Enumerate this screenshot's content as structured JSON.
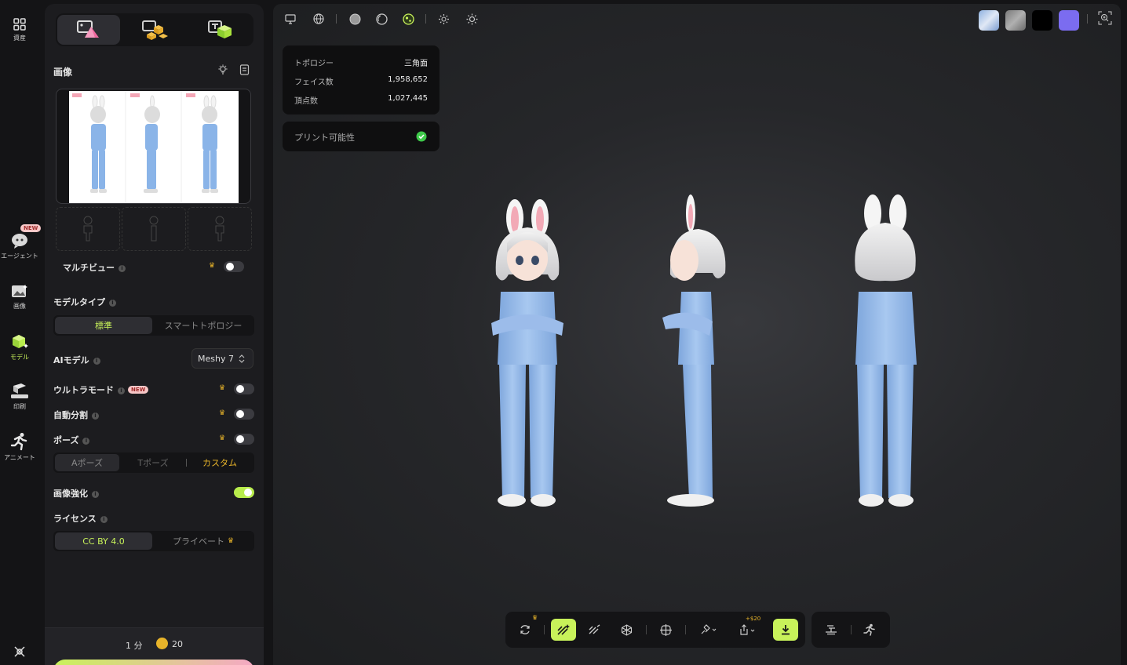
{
  "rail": {
    "items": [
      {
        "label": "資産",
        "icon": "grid-icon"
      },
      {
        "label": "エージェント",
        "icon": "agent-icon",
        "badge": "NEW"
      },
      {
        "label": "画像",
        "icon": "image-icon"
      },
      {
        "label": "モデル",
        "icon": "model-cube-icon",
        "active": true
      },
      {
        "label": "印刷",
        "icon": "printer-icon"
      },
      {
        "label": "アニメート",
        "icon": "running-figure-icon"
      }
    ]
  },
  "panel": {
    "image_section_title": "画像",
    "multiview": {
      "label": "マルチビュー",
      "enabled": false
    },
    "model_type": {
      "label": "モデルタイプ",
      "options": [
        "標準",
        "スマートトポロジー"
      ],
      "selected": "標準"
    },
    "ai_model": {
      "label": "AIモデル",
      "value": "Meshy 7"
    },
    "ultra_mode": {
      "label": "ウルトラモード",
      "badge": "NEW",
      "enabled": false
    },
    "auto_split": {
      "label": "自動分割",
      "enabled": false
    },
    "pose": {
      "label": "ポーズ",
      "enabled": false,
      "options": [
        "Aポーズ",
        "Tポーズ",
        "カスタム"
      ],
      "selected": "Aポーズ"
    },
    "image_enhance": {
      "label": "画像強化",
      "enabled": true
    },
    "license": {
      "label": "ライセンス",
      "options": [
        "CC BY 4.0",
        "プライベート"
      ],
      "selected": "CC BY 4.0"
    },
    "footer": {
      "time": "1 分",
      "credits": "20"
    }
  },
  "viewport": {
    "stats": {
      "topology_label": "トポロジー",
      "topology_value": "三角面",
      "faces_label": "フェイス数",
      "faces_value": "1,958,652",
      "vertices_label": "頂点数",
      "vertices_value": "1,027,445"
    },
    "printability_label": "プリント可能性",
    "toolbar_price": "+$20",
    "colors": {
      "accent": "#c8f25a",
      "swatch_purple": "#7b6cf0"
    }
  }
}
